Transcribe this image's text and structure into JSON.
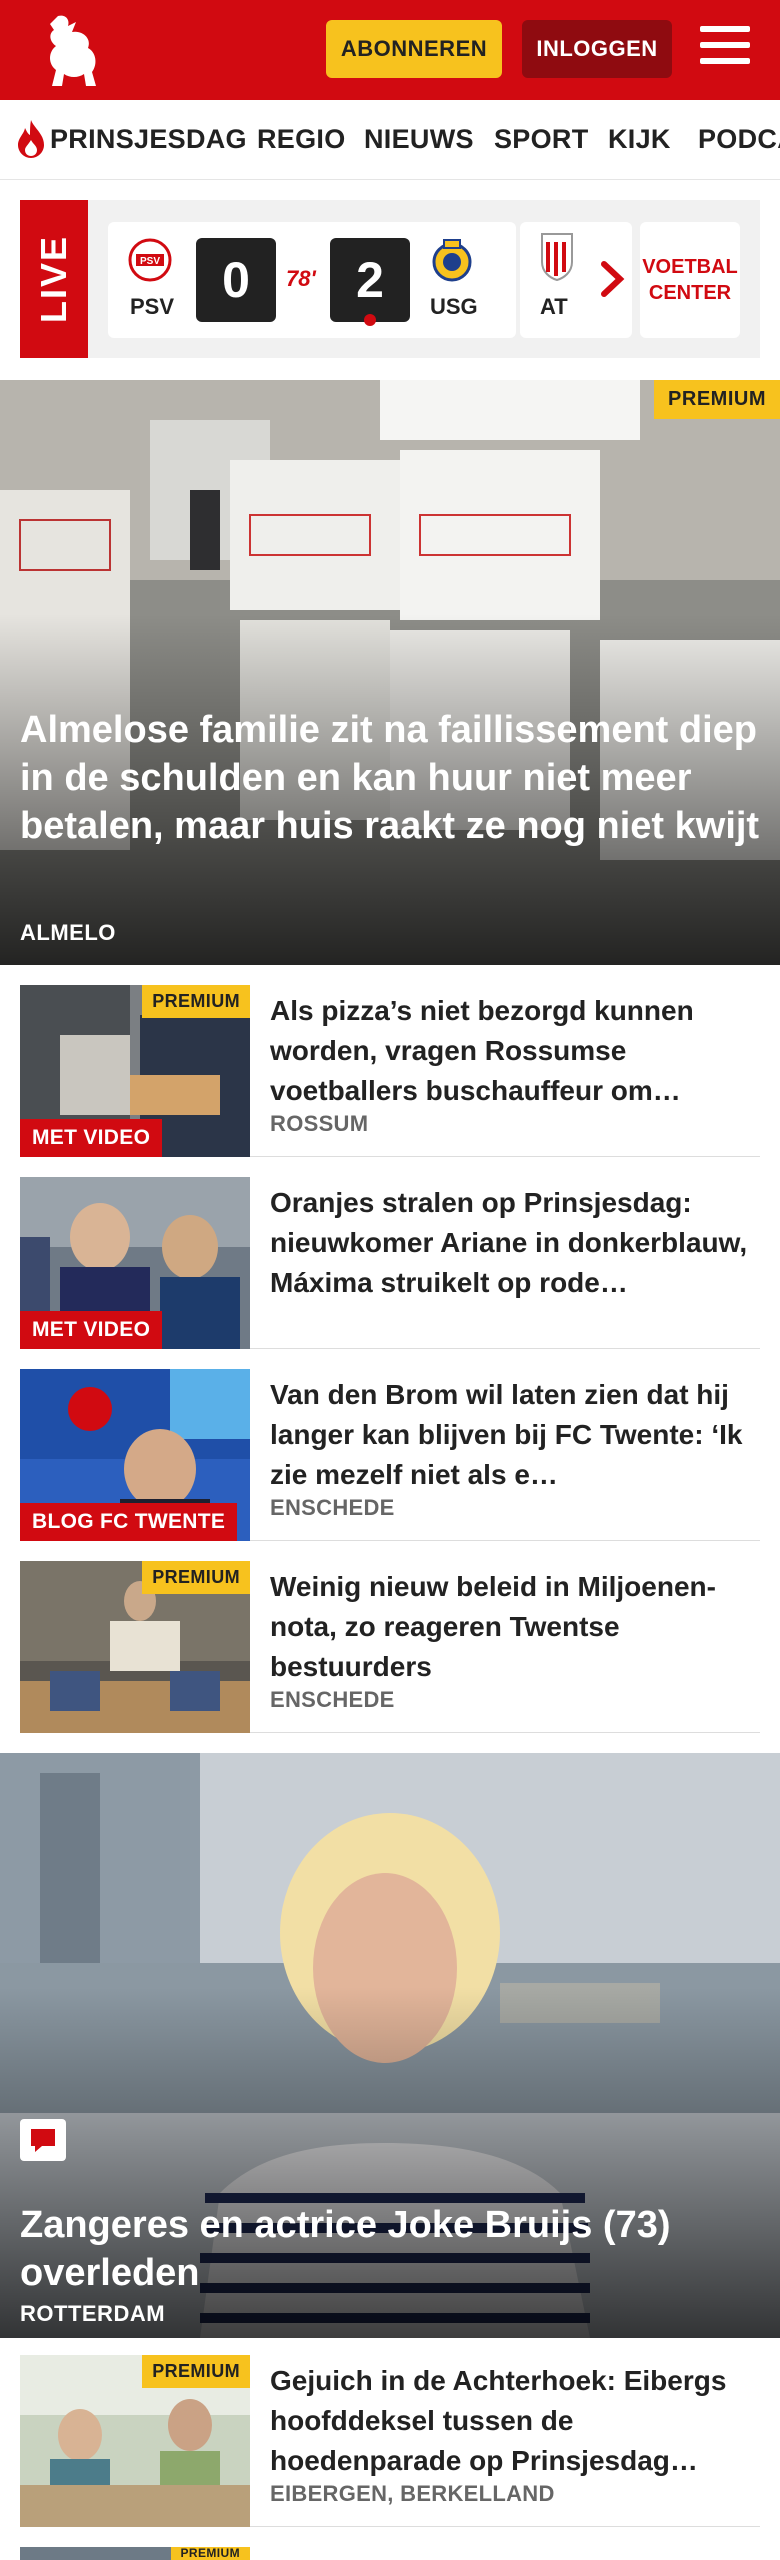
{
  "header": {
    "subscribe_label": "ABONNEREN",
    "login_label": "INLOGGEN"
  },
  "nav": {
    "items": [
      "PRINSJESDAG",
      "REGIO",
      "NIEUWS",
      "SPORT",
      "KIJK",
      "PODCA"
    ]
  },
  "live": {
    "label": "LIVE",
    "match": {
      "home_team": "PSV",
      "home_score": "0",
      "minute": "78'",
      "away_score": "2",
      "away_team": "USG"
    },
    "next_team": "AT",
    "voetbal_center_label": [
      "VOETBAL",
      "CENTER"
    ]
  },
  "hero1": {
    "badge": "PREMIUM",
    "title": "Almelose familie zit na faillissement diep in de schulden en kan huur niet meer betalen, maar huis raakt ze nog niet kwijt",
    "location": "ALMELO"
  },
  "articles": [
    {
      "premium": "PREMIUM",
      "label": "MET VIDEO",
      "title": "Als pizza’s niet bezorgd kunnen worden, vragen Rossumse voetballers buschauffeur om…",
      "location": "ROSSUM"
    },
    {
      "premium": "",
      "label": "MET VIDEO",
      "title": "Oranjes stralen op Prinsjesdag: nieuwkomer Ariane in donker­blauw, Máxima struikelt op rode…",
      "location": ""
    },
    {
      "premium": "",
      "label": "BLOG FC TWENTE",
      "title": "Van den Brom wil laten zien dat hij langer kan blijven bij FC Twente: ‘Ik zie mezelf niet als e…",
      "location": "ENSCHEDE"
    },
    {
      "premium": "PREMIUM",
      "label": "",
      "title": "Weinig nieuw beleid in Miljoenen­nota, zo reageren Twentse bestuurders",
      "location": "ENSCHEDE"
    }
  ],
  "hero2": {
    "title": "Zangeres en actrice Joke Bruijs (73) overleden",
    "location": "ROTTERDAM"
  },
  "articles2": [
    {
      "premium": "PREMIUM",
      "title": "Gejuich in de Achterhoek: Eibergs hoofddeksel tussen de hoedenparade op Prinsjesdag…",
      "location": "EIBERGEN, BERKELLAND"
    },
    {
      "premium": "PREMIUM"
    }
  ],
  "colors": {
    "brand_red": "#d10a11",
    "premium_yellow": "#f7c21e",
    "dark_red": "#8f0b10"
  },
  "icons": [
    "tubantia-horse-logo",
    "hamburger-icon",
    "flame-icon",
    "chevron-right-icon",
    "comment-icon"
  ]
}
